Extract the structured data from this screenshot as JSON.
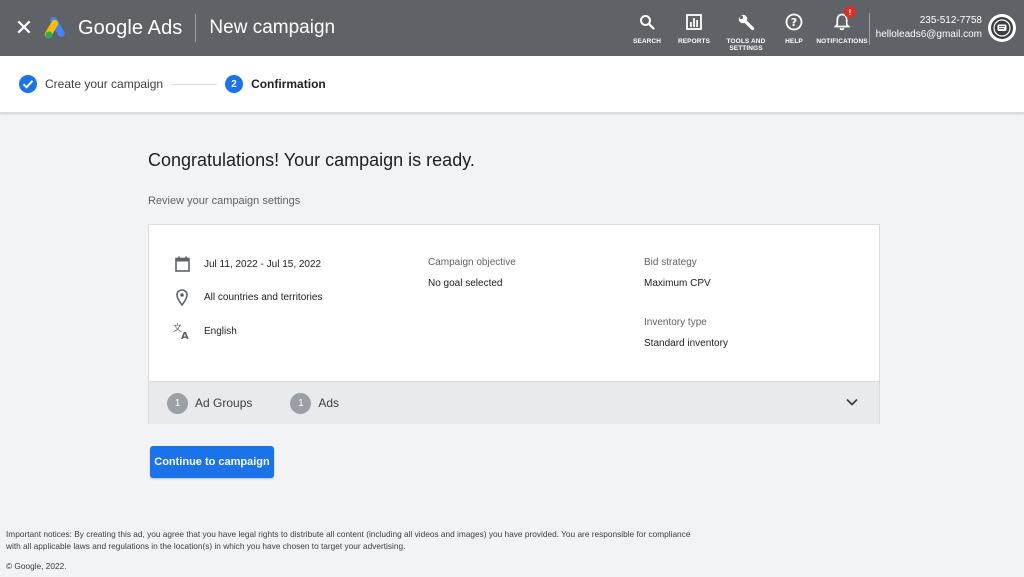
{
  "header": {
    "close_icon": "close-icon",
    "brand": "Google Ads",
    "page_title": "New campaign",
    "tools": [
      {
        "icon": "search-icon",
        "label": "SEARCH"
      },
      {
        "icon": "reports-icon",
        "label": "REPORTS"
      },
      {
        "icon": "wrench-icon",
        "label": "TOOLS AND SETTINGS"
      },
      {
        "icon": "help-icon",
        "label": "HELP"
      },
      {
        "icon": "bell-icon",
        "label": "NOTIFICATIONS",
        "badge": "!"
      }
    ],
    "account": {
      "phone": "235-512-7758",
      "email": "helloleads6@gmail.com"
    }
  },
  "stepper": {
    "steps": [
      {
        "label": "Create your campaign",
        "state": "done"
      },
      {
        "number": "2",
        "label": "Confirmation",
        "state": "active"
      }
    ]
  },
  "main": {
    "headline": "Congratulations! Your campaign is ready.",
    "subhead": "Review your campaign settings",
    "summary": {
      "dates": "Jul 11, 2022 - Jul 15, 2022",
      "locations": "All countries and territories",
      "language": "English",
      "objective_label": "Campaign objective",
      "objective_value": "No goal selected",
      "bid_label": "Bid strategy",
      "bid_value": "Maximum CPV",
      "inventory_label": "Inventory type",
      "inventory_value": "Standard inventory"
    },
    "footer": {
      "ad_groups_count": "1",
      "ad_groups_label": "Ad Groups",
      "ads_count": "1",
      "ads_label": "Ads"
    },
    "continue_button": "Continue to campaign"
  },
  "legal": {
    "notice_line1": "Important notices: By creating this ad, you agree that you have legal rights to distribute all content (including all videos and images) you have provided. You are responsible for compliance",
    "notice_line2": "with all applicable laws and regulations in the location(s) in which you have chosen to target your advertising.",
    "copyright": "© Google, 2022."
  },
  "colors": {
    "header_bg": "#5f6368",
    "primary": "#1a73e8",
    "page_bg": "#f1f3f4"
  }
}
